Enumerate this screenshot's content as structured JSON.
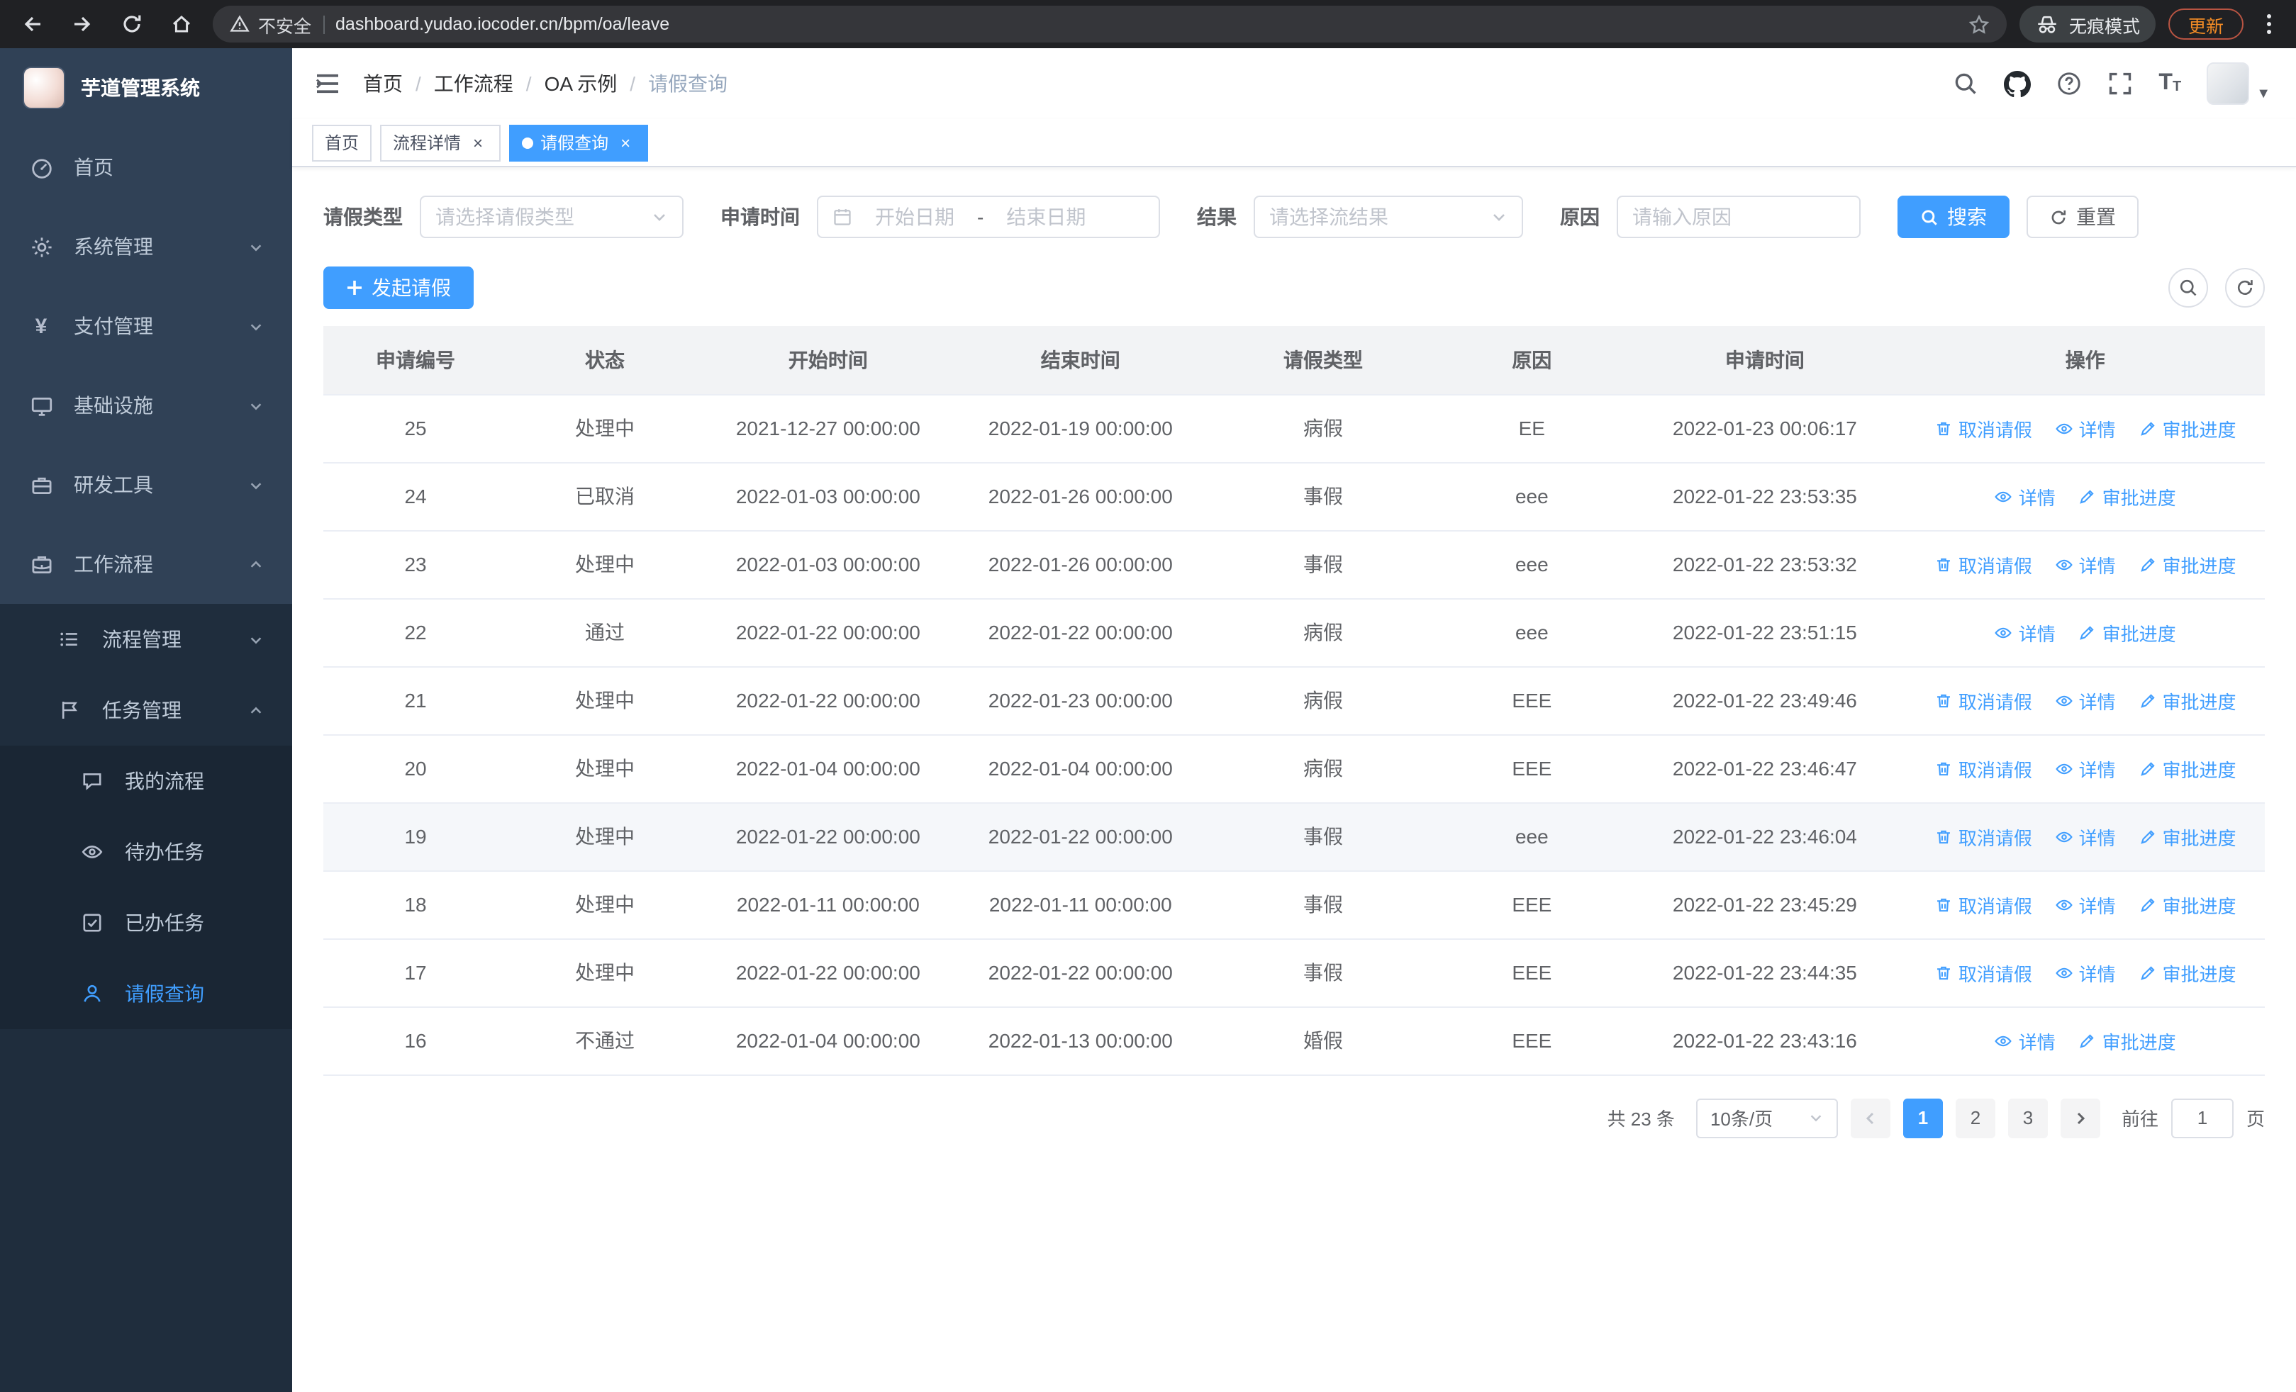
{
  "browser": {
    "security_warning": "不安全",
    "url": "dashboard.yudao.iocoder.cn/bpm/oa/leave",
    "incognito_label": "无痕模式",
    "update_label": "更新"
  },
  "sidebar": {
    "app_title": "芋道管理系统",
    "items": [
      {
        "label": "首页"
      },
      {
        "label": "系统管理"
      },
      {
        "label": "支付管理"
      },
      {
        "label": "基础设施"
      },
      {
        "label": "研发工具"
      },
      {
        "label": "工作流程"
      }
    ],
    "submenu": [
      {
        "label": "流程管理"
      },
      {
        "label": "任务管理"
      }
    ],
    "task_items": [
      {
        "label": "我的流程"
      },
      {
        "label": "待办任务"
      },
      {
        "label": "已办任务"
      },
      {
        "label": "请假查询"
      }
    ]
  },
  "header": {
    "breadcrumb": [
      "首页",
      "工作流程",
      "OA 示例",
      "请假查询"
    ]
  },
  "tabs": [
    {
      "label": "首页"
    },
    {
      "label": "流程详情"
    },
    {
      "label": "请假查询"
    }
  ],
  "filters": {
    "leave_type_label": "请假类型",
    "leave_type_placeholder": "请选择请假类型",
    "apply_time_label": "申请时间",
    "start_date_placeholder": "开始日期",
    "date_separator": "-",
    "end_date_placeholder": "结束日期",
    "result_label": "结果",
    "result_placeholder": "请选择流结果",
    "reason_label": "原因",
    "reason_placeholder": "请输入原因",
    "search_button": "搜索",
    "reset_button": "重置"
  },
  "toolbar": {
    "create_button": "发起请假"
  },
  "table": {
    "columns": [
      "申请编号",
      "状态",
      "开始时间",
      "结束时间",
      "请假类型",
      "原因",
      "申请时间",
      "操作"
    ],
    "action_labels": {
      "cancel": "取消请假",
      "detail": "详情",
      "progress": "审批进度"
    },
    "rows": [
      {
        "id": "25",
        "status": "处理中",
        "start": "2021-12-27 00:00:00",
        "end": "2022-01-19 00:00:00",
        "type": "病假",
        "reason": "EE",
        "applied": "2022-01-23 00:06:17",
        "cancellable": true,
        "hover": false
      },
      {
        "id": "24",
        "status": "已取消",
        "start": "2022-01-03 00:00:00",
        "end": "2022-01-26 00:00:00",
        "type": "事假",
        "reason": "eee",
        "applied": "2022-01-22 23:53:35",
        "cancellable": false,
        "hover": false
      },
      {
        "id": "23",
        "status": "处理中",
        "start": "2022-01-03 00:00:00",
        "end": "2022-01-26 00:00:00",
        "type": "事假",
        "reason": "eee",
        "applied": "2022-01-22 23:53:32",
        "cancellable": true,
        "hover": false
      },
      {
        "id": "22",
        "status": "通过",
        "start": "2022-01-22 00:00:00",
        "end": "2022-01-22 00:00:00",
        "type": "病假",
        "reason": "eee",
        "applied": "2022-01-22 23:51:15",
        "cancellable": false,
        "hover": false
      },
      {
        "id": "21",
        "status": "处理中",
        "start": "2022-01-22 00:00:00",
        "end": "2022-01-23 00:00:00",
        "type": "病假",
        "reason": "EEE",
        "applied": "2022-01-22 23:49:46",
        "cancellable": true,
        "hover": false
      },
      {
        "id": "20",
        "status": "处理中",
        "start": "2022-01-04 00:00:00",
        "end": "2022-01-04 00:00:00",
        "type": "病假",
        "reason": "EEE",
        "applied": "2022-01-22 23:46:47",
        "cancellable": true,
        "hover": false
      },
      {
        "id": "19",
        "status": "处理中",
        "start": "2022-01-22 00:00:00",
        "end": "2022-01-22 00:00:00",
        "type": "事假",
        "reason": "eee",
        "applied": "2022-01-22 23:46:04",
        "cancellable": true,
        "hover": true
      },
      {
        "id": "18",
        "status": "处理中",
        "start": "2022-01-11 00:00:00",
        "end": "2022-01-11 00:00:00",
        "type": "事假",
        "reason": "EEE",
        "applied": "2022-01-22 23:45:29",
        "cancellable": true,
        "hover": false
      },
      {
        "id": "17",
        "status": "处理中",
        "start": "2022-01-22 00:00:00",
        "end": "2022-01-22 00:00:00",
        "type": "事假",
        "reason": "EEE",
        "applied": "2022-01-22 23:44:35",
        "cancellable": true,
        "hover": false
      },
      {
        "id": "16",
        "status": "不通过",
        "start": "2022-01-04 00:00:00",
        "end": "2022-01-13 00:00:00",
        "type": "婚假",
        "reason": "EEE",
        "applied": "2022-01-22 23:43:16",
        "cancellable": false,
        "hover": false
      }
    ]
  },
  "pagination": {
    "total_text": "共 23 条",
    "page_size": "10条/页",
    "pages": [
      "1",
      "2",
      "3"
    ],
    "goto_label": "前往",
    "goto_value": "1",
    "page_suffix": "页"
  },
  "colors": {
    "accent": "#409eff",
    "sidebar_bg": "#304156",
    "submenu_bg": "#1f2d3d"
  }
}
